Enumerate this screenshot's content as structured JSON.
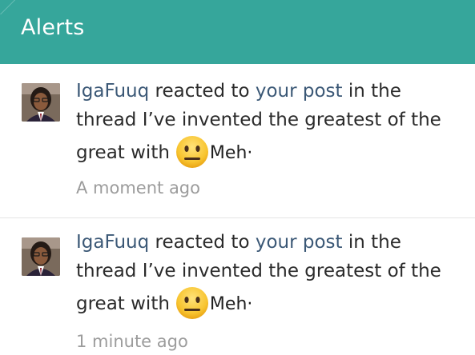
{
  "header": {
    "title": "Alerts",
    "background_color": "#36a69b"
  },
  "alerts": [
    {
      "username": "IgaFuuq",
      "action": "reacted to",
      "target": "your post",
      "thread_prefix": "in the thread",
      "thread_title": "I’ve invented the greatest of the great with",
      "reaction_icon": "neutral-face-emoji",
      "reaction": "Meh·",
      "time": "A moment ago"
    },
    {
      "username": "IgaFuuq",
      "action": "reacted to",
      "target": "your post",
      "thread_prefix": "in the thread",
      "thread_title": "I’ve invented the greatest of the great with",
      "reaction_icon": "neutral-face-emoji",
      "reaction": "Meh·",
      "time": "1 minute ago"
    }
  ],
  "colors": {
    "link": "#3b5876",
    "text": "#2b2b2b",
    "timestamp": "#9c9c9c"
  }
}
